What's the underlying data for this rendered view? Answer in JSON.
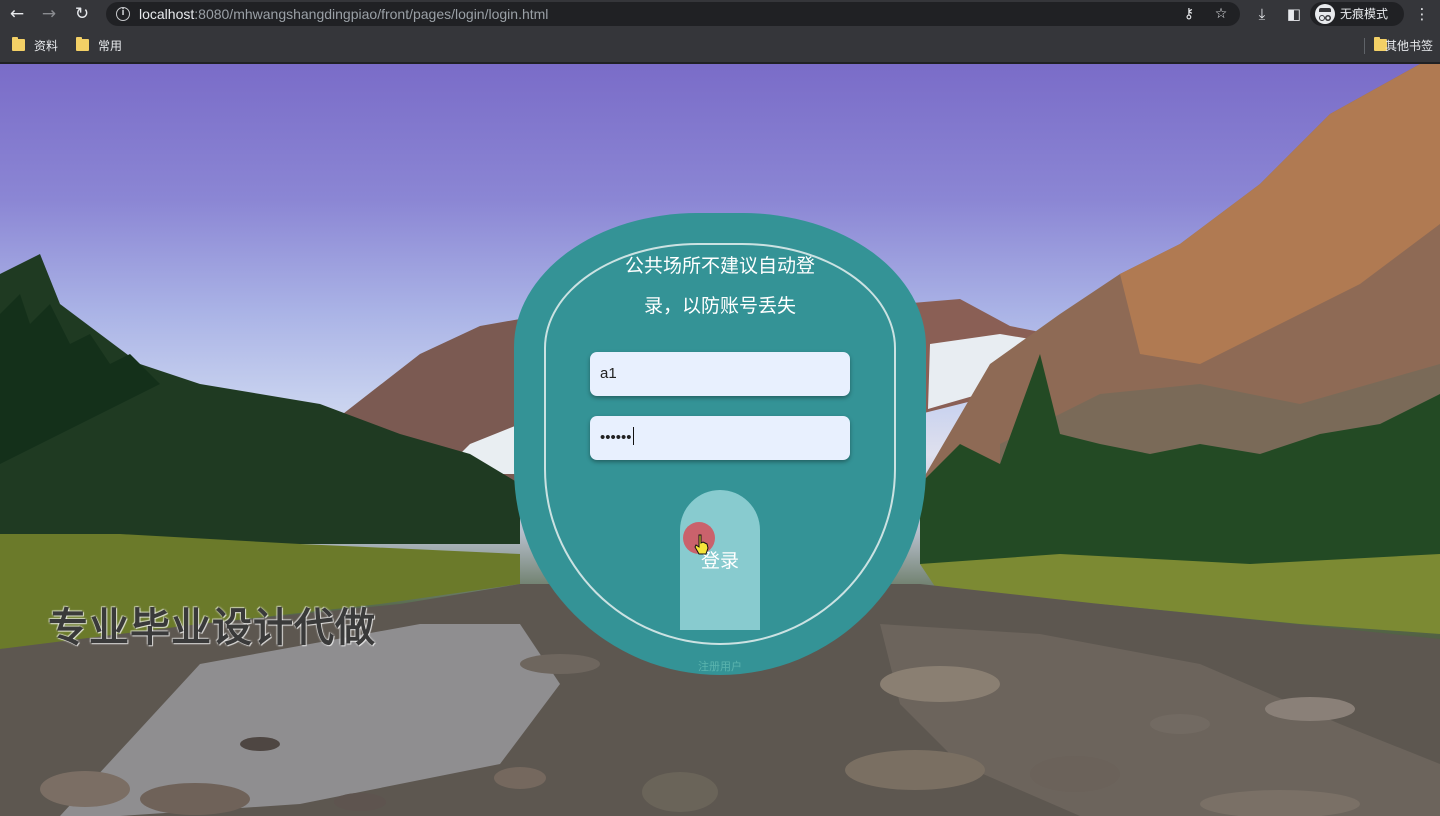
{
  "browser": {
    "url_host": "localhost",
    "url_rest": ":8080/mhwangshangdingpiao/front/pages/login/login.html",
    "incognito_label": "无痕模式",
    "bookmarks": [
      {
        "label": "资料"
      },
      {
        "label": "常用"
      }
    ],
    "other_bookmarks_label": "其他书签"
  },
  "login": {
    "notice_line1": "公共场所不建议自动登",
    "notice_line2": "录，以防账号丢失",
    "username_value": "a1",
    "password_masked": "••••••",
    "login_button_label": "登录",
    "register_link_label": "注册用户"
  },
  "watermark": {
    "text": "专业毕业设计代做"
  },
  "colors": {
    "card": "#349396",
    "login_button": "#88cbcf",
    "input_bg": "#e8f0fe"
  }
}
